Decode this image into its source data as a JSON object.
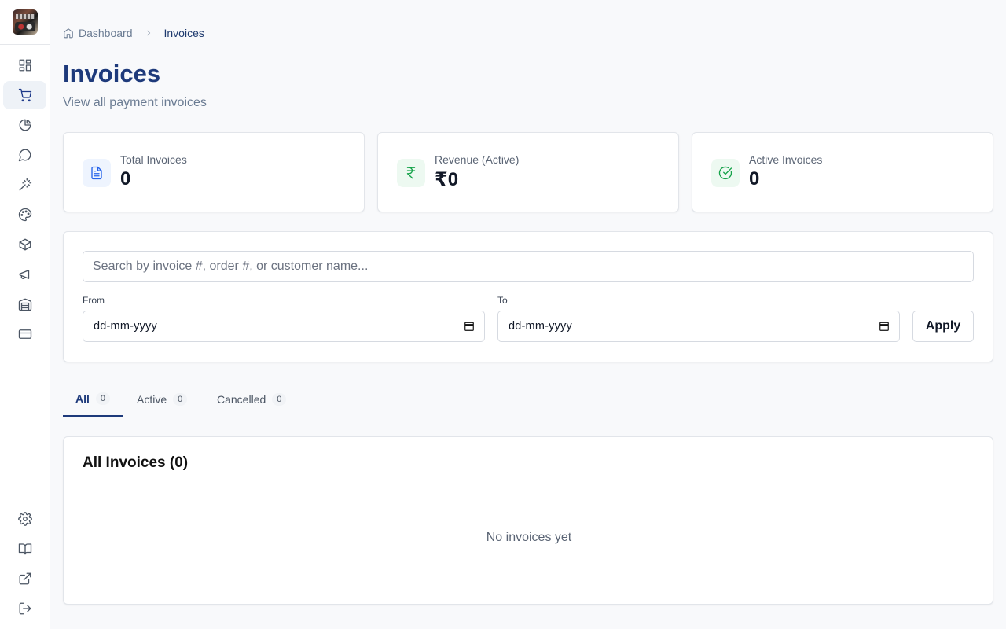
{
  "sidebar": {
    "items": [
      {
        "icon": "dashboard-grid-icon",
        "active": false
      },
      {
        "icon": "shopping-cart-icon",
        "active": true
      },
      {
        "icon": "pie-chart-icon",
        "active": false
      },
      {
        "icon": "message-circle-icon",
        "active": false
      },
      {
        "icon": "magic-wand-icon",
        "active": false
      },
      {
        "icon": "palette-icon",
        "active": false
      },
      {
        "icon": "package-box-icon",
        "active": false
      },
      {
        "icon": "megaphone-icon",
        "active": false
      },
      {
        "icon": "warehouse-icon",
        "active": false
      },
      {
        "icon": "credit-card-icon",
        "active": false
      }
    ],
    "bottom_items": [
      {
        "icon": "settings-gear-icon"
      },
      {
        "icon": "book-open-icon"
      },
      {
        "icon": "external-link-icon"
      },
      {
        "icon": "logout-icon"
      }
    ]
  },
  "breadcrumb": {
    "home": "Dashboard",
    "current": "Invoices"
  },
  "header": {
    "title": "Invoices",
    "subtitle": "View all payment invoices"
  },
  "stats": [
    {
      "label": "Total Invoices",
      "value": "0",
      "icon": "file-text-icon",
      "color": "#2563eb",
      "bg": "#eef4fe"
    },
    {
      "label": "Revenue (Active)",
      "value": "₹0",
      "icon": "rupee-icon",
      "color": "#16a34a",
      "bg": "#edf9f1"
    },
    {
      "label": "Active Invoices",
      "value": "0",
      "icon": "check-circle-icon",
      "color": "#16a34a",
      "bg": "#edf9f1"
    }
  ],
  "filters": {
    "search_placeholder": "Search by invoice #, order #, or customer name...",
    "from_label": "From",
    "to_label": "To",
    "from_value": "dd-mm-yyyy",
    "to_value": "dd-mm-yyyy",
    "apply_label": "Apply"
  },
  "tabs": [
    {
      "label": "All",
      "count": "0",
      "active": true
    },
    {
      "label": "Active",
      "count": "0",
      "active": false
    },
    {
      "label": "Cancelled",
      "count": "0",
      "active": false
    }
  ],
  "list": {
    "title": "All Invoices (0)",
    "empty_text": "No invoices yet"
  },
  "colors": {
    "accent": "#1e3a7b",
    "muted": "#6b7c93"
  }
}
